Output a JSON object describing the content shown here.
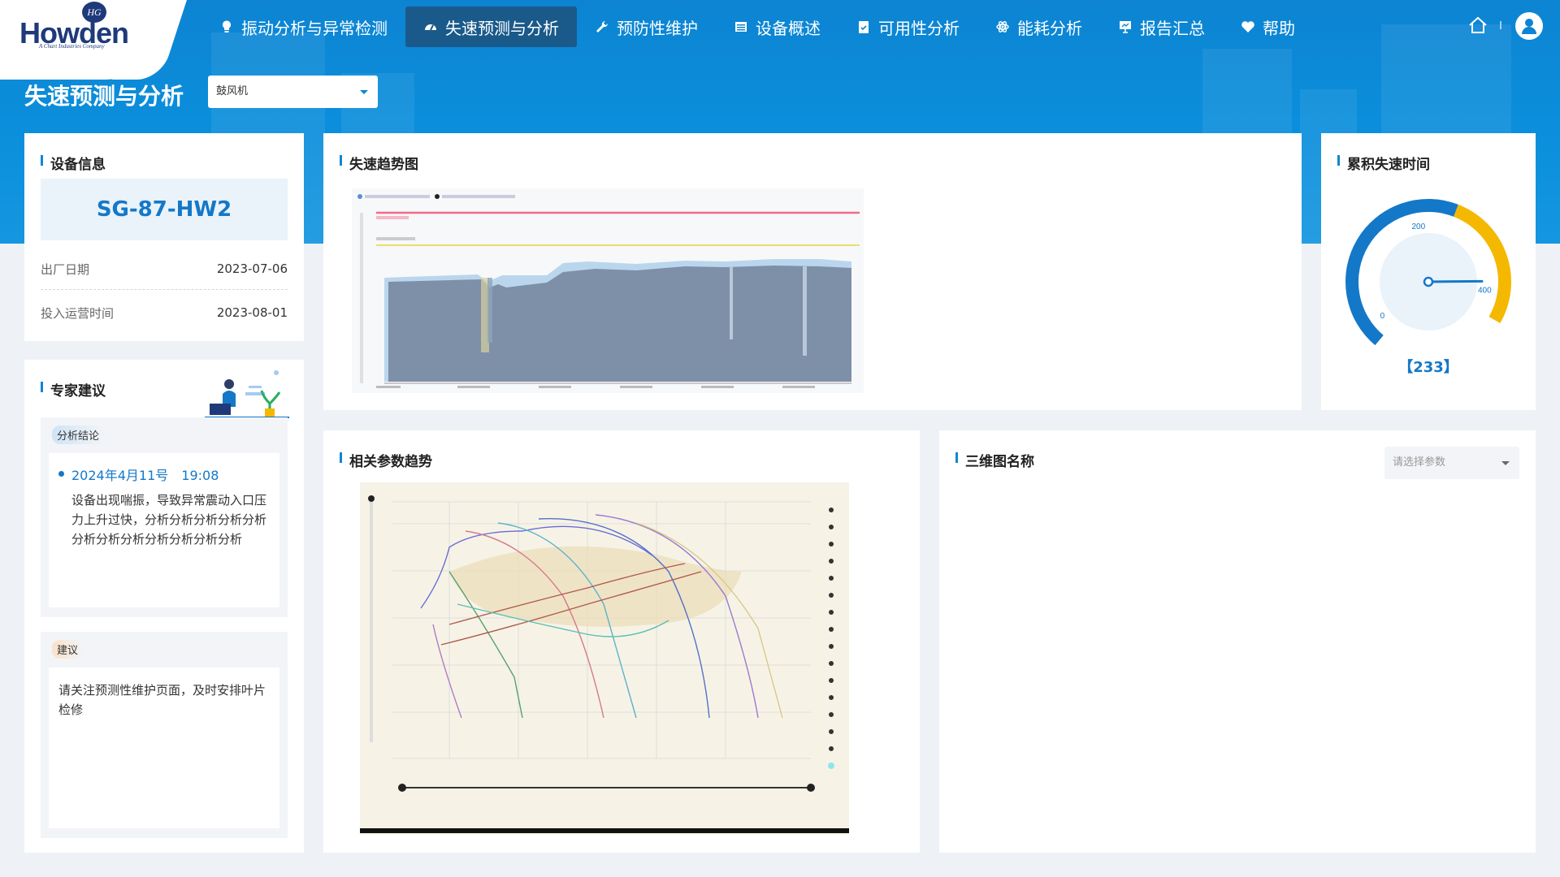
{
  "header": {
    "logo_text": "Howden",
    "logo_sub": "A Chart Industries Company",
    "nav": [
      {
        "label": "振动分析与异常检测",
        "icon": "lightbulb-icon",
        "active": false
      },
      {
        "label": "失速预测与分析",
        "icon": "speedometer-icon",
        "active": true
      },
      {
        "label": "预防性维护",
        "icon": "wrench-icon",
        "active": false
      },
      {
        "label": "设备概述",
        "icon": "list-icon",
        "active": false
      },
      {
        "label": "可用性分析",
        "icon": "clipboard-icon",
        "active": false
      },
      {
        "label": "能耗分析",
        "icon": "atom-icon",
        "active": false
      },
      {
        "label": "报告汇总",
        "icon": "presentation-icon",
        "active": false
      },
      {
        "label": "帮助",
        "icon": "heart-icon",
        "active": false
      }
    ]
  },
  "page": {
    "title": "失速预测与分析",
    "device_select": "鼓风机"
  },
  "device_info": {
    "title": "设备信息",
    "device_id": "SG-87-HW2",
    "rows": [
      {
        "key": "出厂日期",
        "value": "2023-07-06"
      },
      {
        "key": "投入运营时间",
        "value": "2023-08-01"
      }
    ]
  },
  "expert": {
    "title": "专家建议",
    "conclusion_label": "分析结论",
    "conclusion_datetime": "2024年4月11号　19:08",
    "conclusion_text": "设备出现喘振，导致异常震动入口压力上升过快，分析分析分析分析分析分析分析分析分析分析分析分析",
    "advice_label": "建议",
    "advice_text": "请关注预测性维护页面，及时安排叶片检修"
  },
  "stall_trend": {
    "title": "失速趋势图"
  },
  "cumulative": {
    "title": "累积失速时间",
    "value_text": "【233】",
    "chart_data": {
      "type": "gauge",
      "min": 0,
      "max": 400,
      "ticks": [
        "0",
        "200",
        "400"
      ],
      "value": 233,
      "colors": {
        "low": "#1478c8",
        "high": "#f5b800"
      }
    }
  },
  "related": {
    "title": "相关参数趋势"
  },
  "three_d": {
    "title": "三维图名称",
    "placeholder": "请选择参数"
  }
}
